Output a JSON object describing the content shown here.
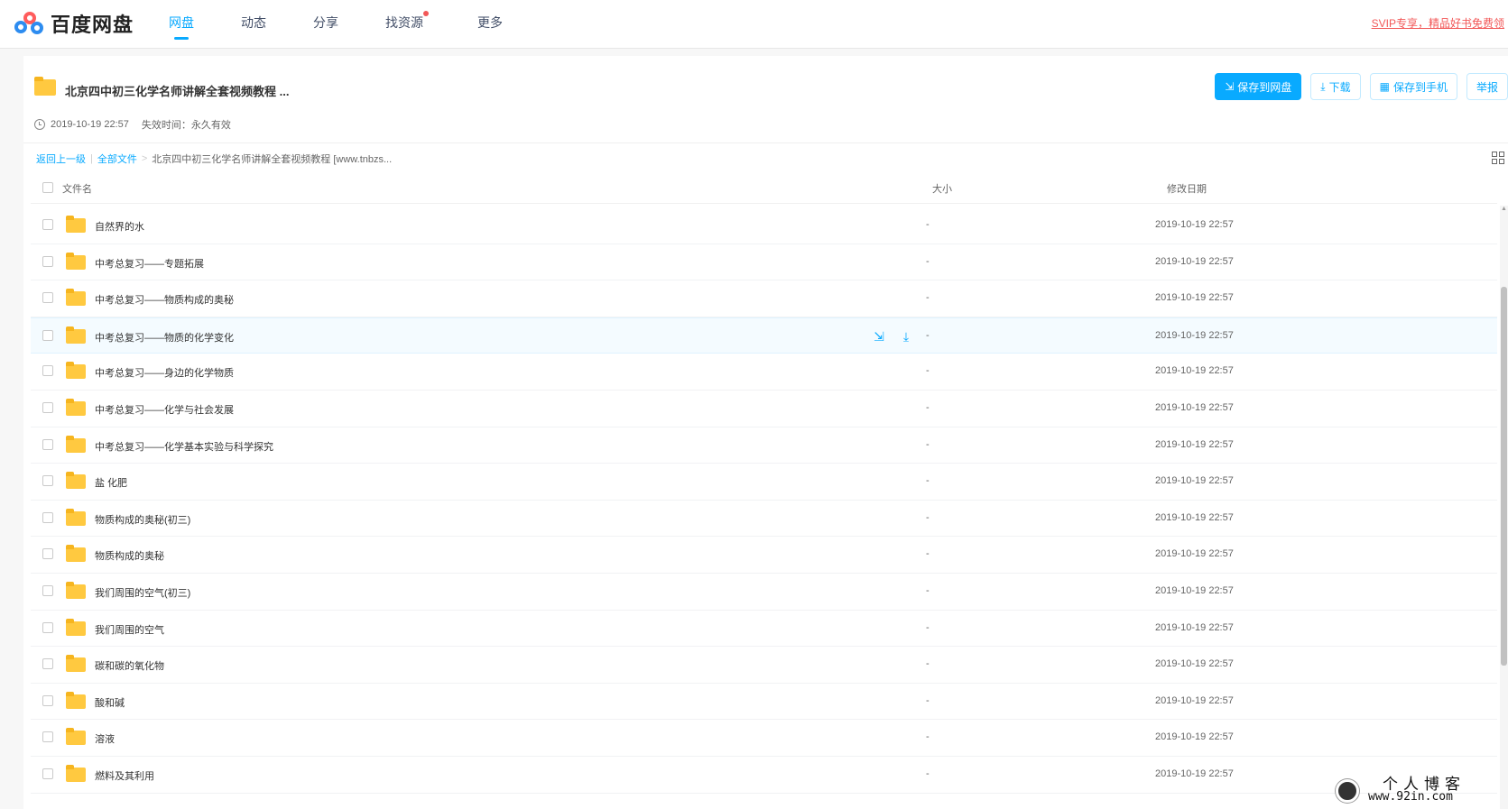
{
  "brand": {
    "name": "百度网盘"
  },
  "nav": {
    "items": [
      {
        "label": "网盘",
        "active": true
      },
      {
        "label": "动态",
        "active": false
      },
      {
        "label": "分享",
        "active": false
      },
      {
        "label": "找资源",
        "active": false,
        "dot": true
      },
      {
        "label": "更多",
        "active": false
      }
    ],
    "svip_link": "SVIP专享，精品好书免费领"
  },
  "share": {
    "title": "北京四中初三化学名师讲解全套视频教程 ...",
    "created": "2019-10-19 22:57",
    "expire_label": "失效时间：",
    "expire_value": "永久有效",
    "buttons": {
      "save": "保存到网盘",
      "download": "下载",
      "save_phone": "保存到手机",
      "report": "举报"
    }
  },
  "breadcrumb": {
    "back": "返回上一级",
    "all_files": "全部文件",
    "current": "北京四中初三化学名师讲解全套视频教程 [www.tnbzs..."
  },
  "list": {
    "headers": {
      "name": "文件名",
      "size": "大小",
      "date": "修改日期"
    },
    "rows": [
      {
        "name": "自然界的水",
        "size": "-",
        "date": "2019-10-19 22:57"
      },
      {
        "name": "中考总复习——专题拓展",
        "size": "-",
        "date": "2019-10-19 22:57"
      },
      {
        "name": "中考总复习——物质构成的奥秘",
        "size": "-",
        "date": "2019-10-19 22:57"
      },
      {
        "name": "中考总复习——物质的化学变化",
        "size": "-",
        "date": "2019-10-19 22:57",
        "hover": true
      },
      {
        "name": "中考总复习——身边的化学物质",
        "size": "-",
        "date": "2019-10-19 22:57"
      },
      {
        "name": "中考总复习——化学与社会发展",
        "size": "-",
        "date": "2019-10-19 22:57"
      },
      {
        "name": "中考总复习——化学基本实验与科学探究",
        "size": "-",
        "date": "2019-10-19 22:57"
      },
      {
        "name": "盐 化肥",
        "size": "-",
        "date": "2019-10-19 22:57"
      },
      {
        "name": "物质构成的奥秘(初三)",
        "size": "-",
        "date": "2019-10-19 22:57"
      },
      {
        "name": "物质构成的奥秘",
        "size": "-",
        "date": "2019-10-19 22:57"
      },
      {
        "name": "我们周围的空气(初三)",
        "size": "-",
        "date": "2019-10-19 22:57"
      },
      {
        "name": "我们周围的空气",
        "size": "-",
        "date": "2019-10-19 22:57"
      },
      {
        "name": "碳和碳的氧化物",
        "size": "-",
        "date": "2019-10-19 22:57"
      },
      {
        "name": "酸和碱",
        "size": "-",
        "date": "2019-10-19 22:57"
      },
      {
        "name": "溶液",
        "size": "-",
        "date": "2019-10-19 22:57"
      },
      {
        "name": "燃料及其利用",
        "size": "-",
        "date": "2019-10-19 22:57"
      }
    ]
  },
  "watermark": {
    "title": "个人博客",
    "url": "www.92in.com"
  },
  "colors": {
    "accent": "#09aaff",
    "folder": "#ffc940",
    "svip": "#f25858"
  }
}
